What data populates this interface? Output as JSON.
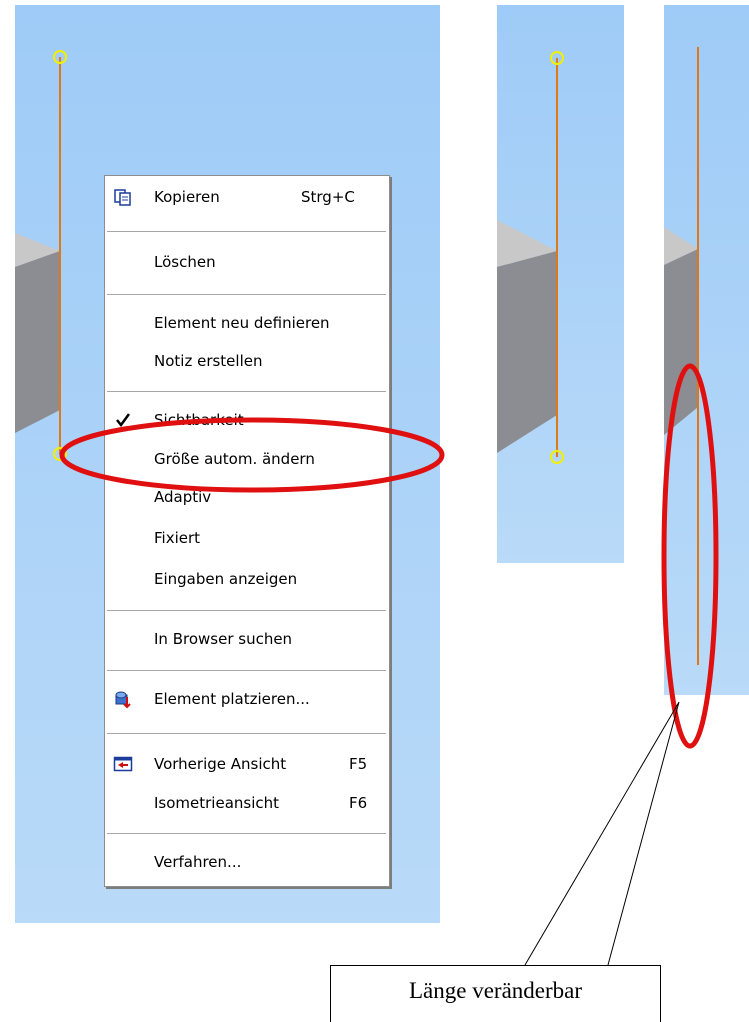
{
  "context_menu": {
    "items": [
      {
        "label": "Kopieren",
        "shortcut": "Strg+C",
        "icon": "copy-icon"
      },
      {
        "label": "Löschen"
      },
      {
        "label": "Element neu definieren"
      },
      {
        "label": "Notiz erstellen"
      },
      {
        "label": "Sichtbarkeit",
        "checked": true,
        "icon": "checkmark-icon"
      },
      {
        "label": "Größe autom. ändern"
      },
      {
        "label": "Adaptiv"
      },
      {
        "label": "Fixiert"
      },
      {
        "label": "Eingaben anzeigen"
      },
      {
        "label": "In Browser suchen"
      },
      {
        "label": "Element platzieren...",
        "icon": "place-component-icon"
      },
      {
        "label": "Vorherige Ansicht",
        "shortcut": "F5",
        "icon": "previous-view-icon"
      },
      {
        "label": "Isometrieansicht",
        "shortcut": "F6"
      },
      {
        "label": "Verfahren..."
      }
    ]
  },
  "callout": {
    "text": "Länge veränderbar"
  },
  "colors": {
    "viewport_top": "#9ecbf7",
    "viewport_bottom": "#b9daf8",
    "work_axis": "#e07818",
    "endpoint_circle": "#f0f000",
    "highlight_ellipse": "#e01010",
    "solid_face_top": "#c8c8c8",
    "solid_face_side": "#8b8d92"
  }
}
